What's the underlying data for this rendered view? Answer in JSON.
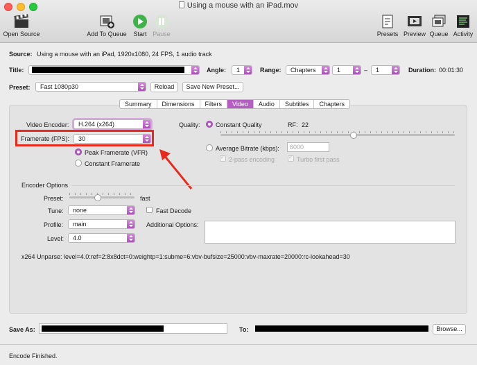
{
  "window": {
    "title": "Using a mouse with an iPad.mov"
  },
  "toolbar": {
    "open_source": "Open Source",
    "add_to_queue": "Add To Queue",
    "start": "Start",
    "pause": "Pause",
    "presets": "Presets",
    "preview": "Preview",
    "queue": "Queue",
    "activity": "Activity"
  },
  "source": {
    "label": "Source:",
    "value": "Using a mouse with an iPad, 1920x1080, 24 FPS, 1 audio track"
  },
  "title_row": {
    "label": "Title:",
    "angle_label": "Angle:",
    "angle_value": "1",
    "range_label": "Range:",
    "range_type": "Chapters",
    "range_start": "1",
    "range_sep": "–",
    "range_end": "1",
    "duration_label": "Duration:",
    "duration_value": "00:01:30"
  },
  "preset_row": {
    "label": "Preset:",
    "value": "Fast 1080p30",
    "reload": "Reload",
    "save_new": "Save New Preset..."
  },
  "tabs": [
    "Summary",
    "Dimensions",
    "Filters",
    "Video",
    "Audio",
    "Subtitles",
    "Chapters"
  ],
  "active_tab": "Video",
  "video": {
    "encoder_label": "Video Encoder:",
    "encoder_value": "H.264 (x264)",
    "framerate_label": "Framerate (FPS):",
    "framerate_value": "30",
    "peak_vfr": "Peak Framerate (VFR)",
    "constant_fr": "Constant Framerate",
    "quality_label": "Quality:",
    "constant_quality": "Constant Quality",
    "rf_label": "RF:",
    "rf_value": "22",
    "avg_bitrate": "Average Bitrate (kbps):",
    "bitrate_value": "6000",
    "two_pass": "2-pass encoding",
    "turbo": "Turbo first pass"
  },
  "encoder_options": {
    "heading": "Encoder Options",
    "preset_label": "Preset:",
    "preset_value": "fast",
    "tune_label": "Tune:",
    "tune_value": "none",
    "fast_decode": "Fast Decode",
    "profile_label": "Profile:",
    "profile_value": "main",
    "additional_label": "Additional Options:",
    "level_label": "Level:",
    "level_value": "4.0",
    "unparse": "x264 Unparse: level=4.0:ref=2:8x8dct=0:weightp=1:subme=6:vbv-bufsize=25000:vbv-maxrate=20000:rc-lookahead=30"
  },
  "save_row": {
    "save_as_label": "Save As:",
    "to_label": "To:",
    "browse": "Browse..."
  },
  "status": "Encode Finished.",
  "colors": {
    "accent": "#b35ec0",
    "highlight": "#e62b1e"
  }
}
